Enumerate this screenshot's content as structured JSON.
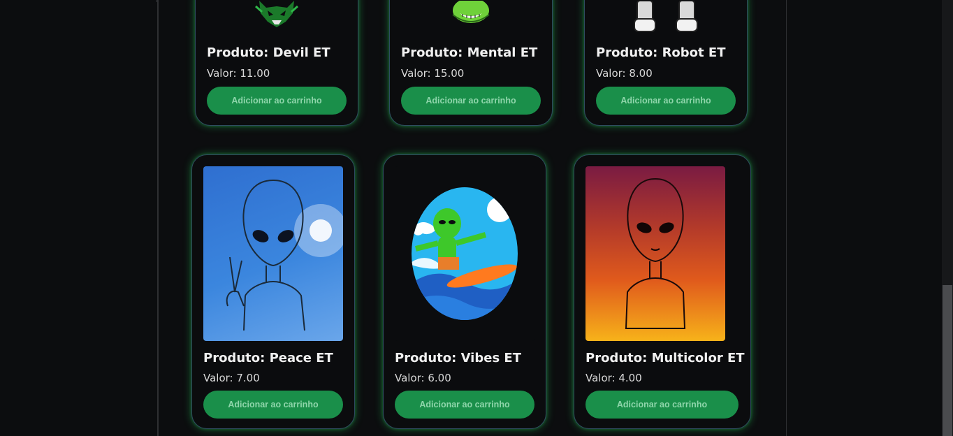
{
  "products_top": [
    {
      "title": "Produto: Devil ET",
      "price": "Valor: 11.00",
      "button": "Adicionar ao carrinho",
      "image": "devil-alien-icon"
    },
    {
      "title": "Produto: Mental ET",
      "price": "Valor: 15.00",
      "button": "Adicionar ao carrinho",
      "image": "mental-alien-icon"
    },
    {
      "title": "Produto: Robot ET",
      "price": "Valor: 8.00",
      "button": "Adicionar ao carrinho",
      "image": "robot-alien-icon"
    }
  ],
  "products_bottom": [
    {
      "title": "Produto: Peace ET",
      "price": "Valor: 7.00",
      "button": "Adicionar ao carrinho",
      "image": "peace-alien-image"
    },
    {
      "title": "Produto: Vibes ET",
      "price": "Valor: 6.00",
      "button": "Adicionar ao carrinho",
      "image": "surfing-alien-image"
    },
    {
      "title": "Produto: Multicolor ET",
      "price": "Valor: 4.00",
      "button": "Adicionar ao carrinho",
      "image": "multicolor-alien-image"
    }
  ],
  "colors": {
    "accent": "#1a8f4a",
    "glow": "#28c85a",
    "card_border": "#2f4b60"
  }
}
